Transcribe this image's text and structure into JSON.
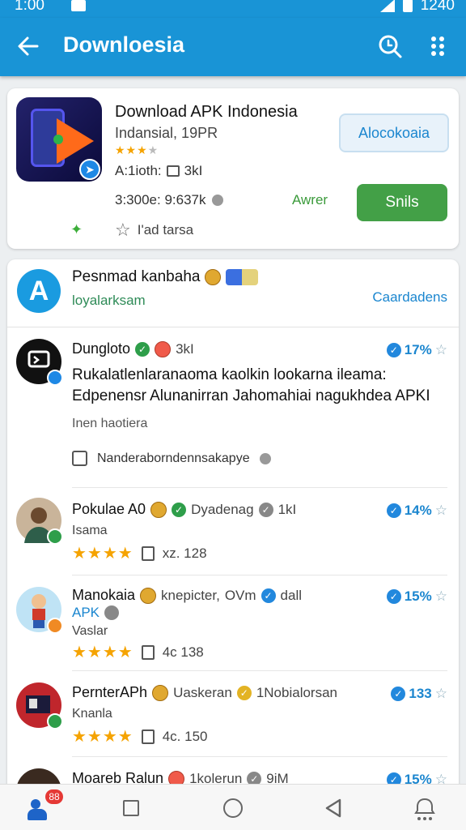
{
  "status_bar": {
    "time": "1:00",
    "battery_text": "1240"
  },
  "app_bar": {
    "title": "Downloesia"
  },
  "app_card": {
    "title": "Download APK Indonesia",
    "developer": "Indansial, 19PR",
    "meta": "A:1ioth:",
    "downloads": "3kI",
    "size": "3:300e: 9:637k",
    "rate_label": "I'ad tarsa",
    "install_label": "Alocokoaia",
    "aware_label": "Awrer",
    "action_label": "Snils",
    "colors": {
      "brand": "#1994d6",
      "action": "#43a047"
    }
  },
  "feed_header": {
    "name": "Pesnmad kanbaha",
    "subtitle": "loyalarksam",
    "link": "Caardadens"
  },
  "posts": [
    {
      "name": "Dungloto",
      "count": "3kI",
      "score": "17%",
      "body": "Rukalatlenlaranaoma kaolkin lookarna ileama: Edpenensr Alunanirran Jahomahiai nagukhdea APKI",
      "hint": "Inen haotiera",
      "check": "Nanderaborndennsakapye"
    },
    {
      "name": "Pokulae A0",
      "extra": "Dyadenag",
      "count": "1kI",
      "score": "14%",
      "line": "Isama",
      "rating": "xz. 128"
    },
    {
      "name": "Manokaia",
      "extra": "knepicter,",
      "extra2": "OVm",
      "extra3": "dall",
      "score": "15%",
      "apk": "APK",
      "line": "Vaslar",
      "rating": "4c 138"
    },
    {
      "name": "PernterAPh",
      "extra": "Uaskeran",
      "extra2": "1Nobialorsan",
      "score": "133",
      "line": "Knanla",
      "rating": "4c. 150"
    },
    {
      "name": "Moareb Ralun",
      "extra": "1kolerun",
      "extra2": "9iM",
      "score": "15%"
    }
  ],
  "nav_bar": {
    "badge": "88"
  }
}
